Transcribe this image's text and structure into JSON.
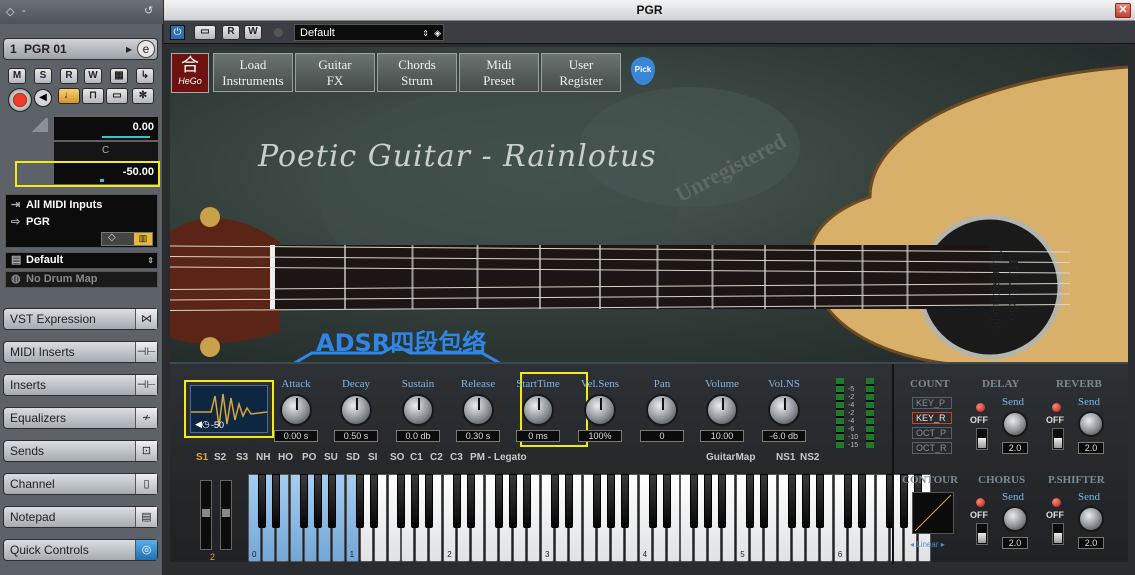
{
  "inspector": {
    "track_number": "1",
    "track_name": "PGR 01",
    "buttons": [
      "M",
      "S",
      "R",
      "W"
    ],
    "volume": "0.00",
    "pan_letter": "C",
    "pan_value": "-50.00",
    "input": "All MIDI Inputs",
    "output": "PGR",
    "program": "Default",
    "drum_map": "No Drum Map",
    "sections": [
      "VST Expression",
      "MIDI Inserts",
      "Inserts",
      "Equalizers",
      "Sends",
      "Channel",
      "Notepad",
      "Quick Controls"
    ]
  },
  "window": {
    "title": "PGR",
    "preset": "Default",
    "toolbar_buttons": [
      "R",
      "W"
    ]
  },
  "header": {
    "logo_char": "合",
    "logo_sub": "HeGo",
    "tabs": [
      {
        "line1": "Load",
        "line2": "Instruments"
      },
      {
        "line1": "Guitar",
        "line2": "FX"
      },
      {
        "line1": "Chords",
        "line2": "Strum"
      },
      {
        "line1": "Midi",
        "line2": "Preset"
      },
      {
        "line1": "User",
        "line2": "Register"
      }
    ],
    "pick": "Pick",
    "script_title": "Poetic Guitar - Rainlotus",
    "unregistered": "Unregistered",
    "soundhole_label_1": "H.E.Audio",
    "soundhole_label_2": "Timesconcept",
    "annotation": "ADSR四段包络"
  },
  "envelope": {
    "value": "-50"
  },
  "knobs": [
    {
      "label": "Attack",
      "value": "0.00 s"
    },
    {
      "label": "Decay",
      "value": "0.50 s"
    },
    {
      "label": "Sustain",
      "value": "0.0 db"
    },
    {
      "label": "Release",
      "value": "0.30 s"
    },
    {
      "label": "StartTime",
      "value": "0 ms"
    },
    {
      "label": "Vel.Sens",
      "value": "100%"
    },
    {
      "label": "Pan",
      "value": "0"
    },
    {
      "label": "Volume",
      "value": "10.00"
    },
    {
      "label": "Vol.NS",
      "value": "-6.0 db"
    }
  ],
  "meter_scale": [
    "-5",
    "-2",
    "-4",
    "-2",
    "-4",
    "-6",
    "-10",
    "-15"
  ],
  "articulations": [
    "S1",
    "S2",
    "S3",
    "NH",
    "HO",
    "PO",
    "SU",
    "SD",
    "SI",
    "SO",
    "C1",
    "C2",
    "C3",
    "PM - Legato"
  ],
  "guitar_map": "GuitarMap",
  "ns": [
    "NS1",
    "NS2"
  ],
  "right_panel": {
    "count": "COUNT",
    "delay": "DELAY",
    "reverb": "REVERB",
    "contour": "CONTOUR",
    "chorus": "CHORUS",
    "pshifter": "P.SHIFTER",
    "send": "Send",
    "off": "OFF",
    "key_options": [
      "KEY_P",
      "KEY_R",
      "OCT_P",
      "OCT_R"
    ],
    "send_values": [
      "2.0",
      "2.0",
      "2.0",
      "2.0"
    ],
    "contour_mode": "Linear"
  },
  "keyboard": {
    "octaves": [
      "0",
      "1",
      "2",
      "3",
      "4",
      "5",
      "6"
    ],
    "pitch_value": "2"
  }
}
